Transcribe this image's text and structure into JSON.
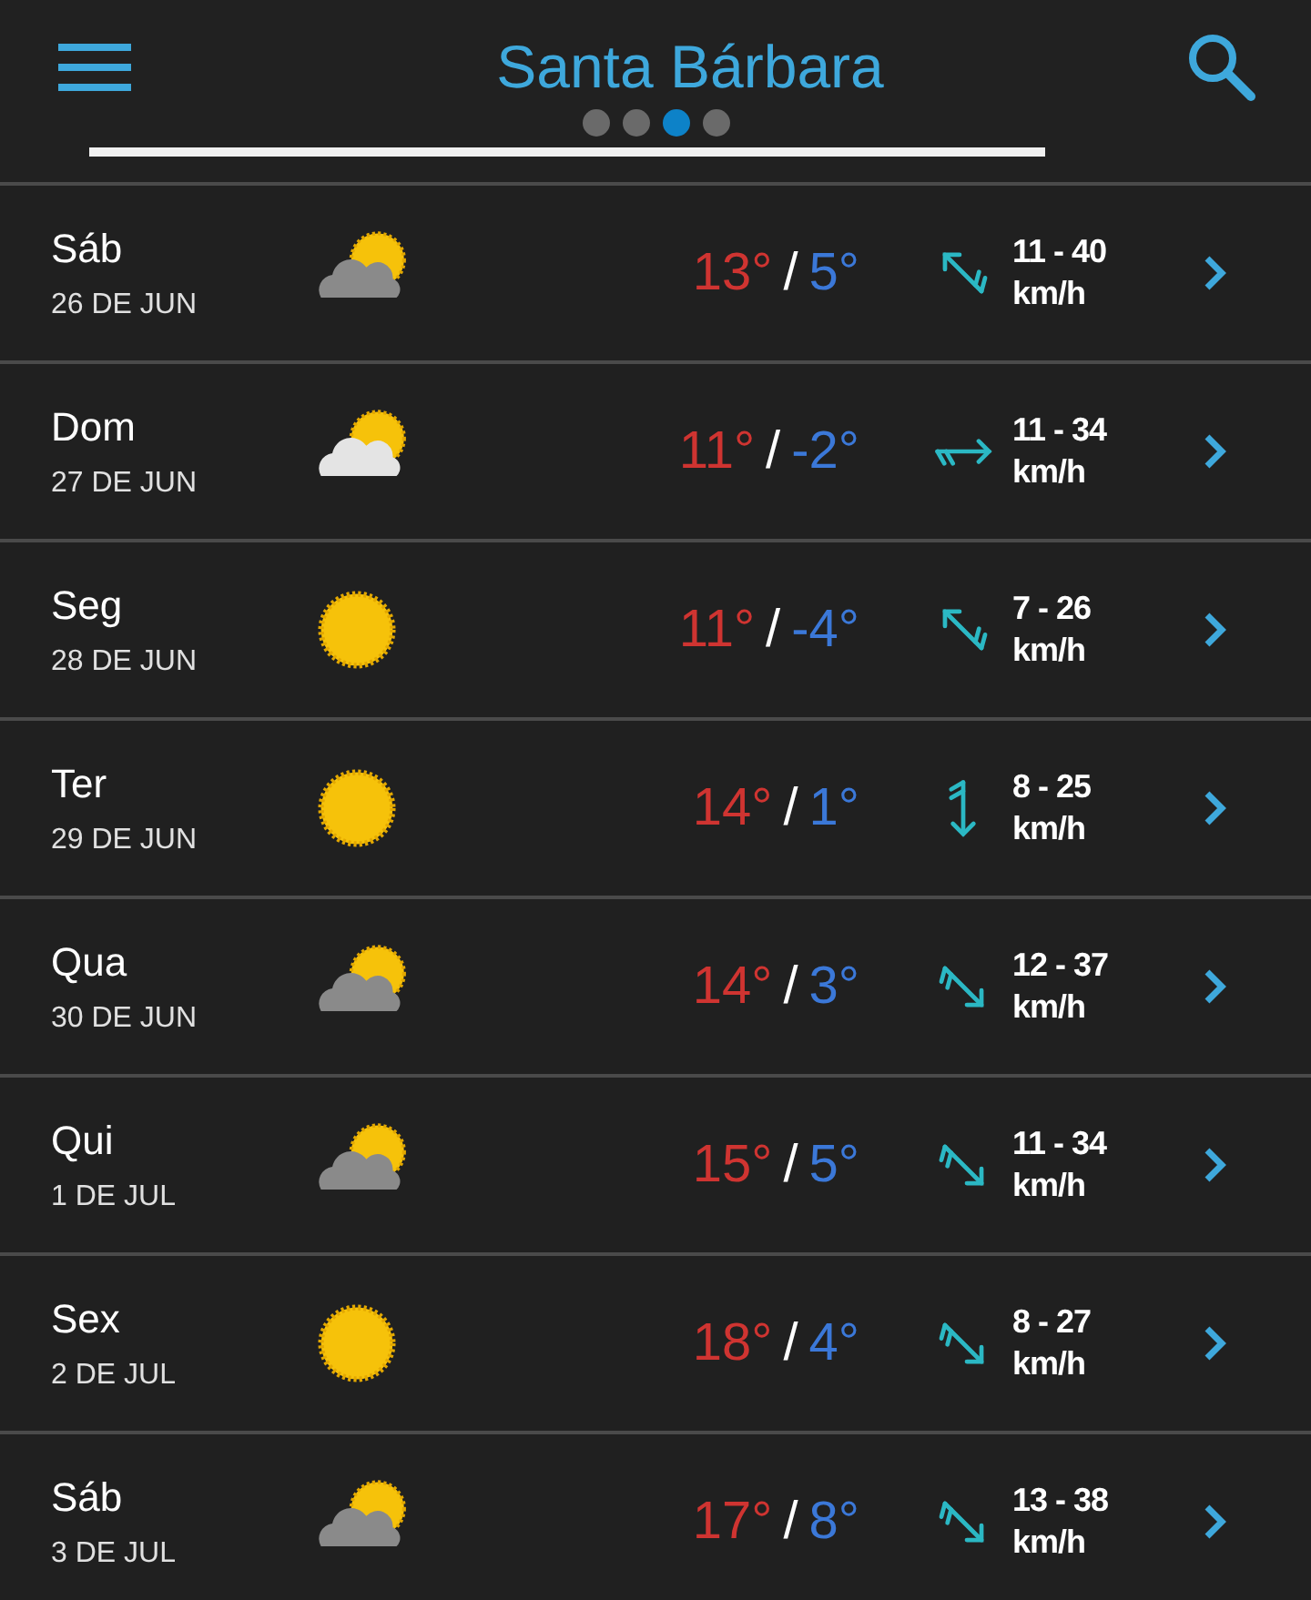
{
  "header": {
    "title": "Santa Bárbara",
    "pages": [
      {
        "selected": false
      },
      {
        "selected": false
      },
      {
        "selected": true
      },
      {
        "selected": false
      }
    ]
  },
  "days": [
    {
      "day": "Sáb",
      "date": "26 DE JUN",
      "sky": {
        "kind": "cloud_grey"
      },
      "high": "13°",
      "separator": "/",
      "low": "5°",
      "wind_arrow": {
        "kind": "nw"
      },
      "wind": "11 - 40",
      "unit": "km/h"
    },
    {
      "day": "Dom",
      "date": "27 DE JUN",
      "sky": {
        "kind": "cloud_white"
      },
      "high": "11°",
      "separator": "/",
      "low": "-2°",
      "wind_arrow": {
        "kind": "e"
      },
      "wind": "11 - 34",
      "unit": "km/h"
    },
    {
      "day": "Seg",
      "date": "28 DE JUN",
      "sky": {
        "kind": "sun"
      },
      "high": "11°",
      "separator": "/",
      "low": "-4°",
      "wind_arrow": {
        "kind": "nw"
      },
      "wind": "7 - 26",
      "unit": "km/h"
    },
    {
      "day": "Ter",
      "date": "29 DE JUN",
      "sky": {
        "kind": "sun"
      },
      "high": "14°",
      "separator": "/",
      "low": "1°",
      "wind_arrow": {
        "kind": "s"
      },
      "wind": "8 - 25",
      "unit": "km/h"
    },
    {
      "day": "Qua",
      "date": "30 DE JUN",
      "sky": {
        "kind": "cloud_grey"
      },
      "high": "14°",
      "separator": "/",
      "low": "3°",
      "wind_arrow": {
        "kind": "se"
      },
      "wind": "12 - 37",
      "unit": "km/h"
    },
    {
      "day": "Qui",
      "date": "1 DE JUL",
      "sky": {
        "kind": "cloud_grey"
      },
      "high": "15°",
      "separator": "/",
      "low": "5°",
      "wind_arrow": {
        "kind": "se"
      },
      "wind": "11 - 34",
      "unit": "km/h"
    },
    {
      "day": "Sex",
      "date": "2 DE JUL",
      "sky": {
        "kind": "sun"
      },
      "high": "18°",
      "separator": "/",
      "low": "4°",
      "wind_arrow": {
        "kind": "se"
      },
      "wind": "8 - 27",
      "unit": "km/h"
    },
    {
      "day": "Sáb",
      "date": "3 DE JUL",
      "sky": {
        "kind": "cloud_grey"
      },
      "high": "17°",
      "separator": "/",
      "low": "8°",
      "wind_arrow": {
        "kind": "se"
      },
      "wind": "13 - 38",
      "unit": "km/h"
    }
  ]
}
